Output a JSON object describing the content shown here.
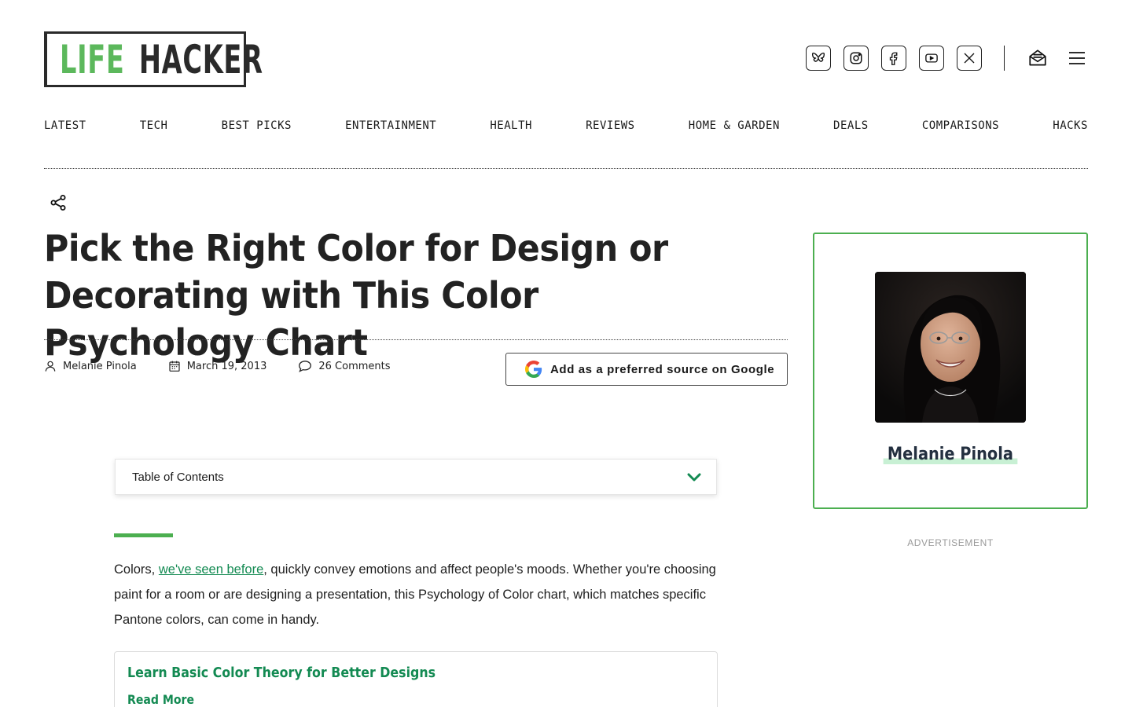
{
  "brand": {
    "logo_left": "LIFE",
    "logo_right": "HACKER",
    "logo_green": "#5cb85c"
  },
  "social": {
    "icons": [
      "bluesky-icon",
      "instagram-icon",
      "facebook-icon",
      "youtube-icon",
      "x-icon"
    ],
    "newsletter_icon": "newsletter-icon",
    "menu_icon": "hamburger-menu-icon"
  },
  "nav": {
    "items": [
      "LATEST",
      "TECH",
      "BEST PICKS",
      "ENTERTAINMENT",
      "HEALTH",
      "REVIEWS",
      "HOME & GARDEN",
      "DEALS",
      "COMPARISONS",
      "HACKS"
    ]
  },
  "article": {
    "title": "Pick the Right Color for Design or Decorating with This Color Psychology Chart",
    "author": "Melanie Pinola",
    "date": "March 19, 2013",
    "comments": "26 Comments",
    "google_button": "Add as a preferred source on Google",
    "toc_label": "Table of Contents",
    "body_prefix": "Colors, ",
    "body_link": "we've seen before",
    "body_suffix": ", quickly convey emotions and affect people's moods. Whether you're choosing paint for a room or are designing a presentation, this Psychology of Color chart, which matches specific Pantone colors, can come in handy.",
    "related_title": "Learn Basic Color Theory for Better Designs",
    "related_more": "Read More"
  },
  "sidebar": {
    "author_name": "Melanie Pinola",
    "ad_label": "ADVERTISEMENT"
  },
  "colors": {
    "accent_green": "#4caf50",
    "link_green": "#138a52"
  }
}
